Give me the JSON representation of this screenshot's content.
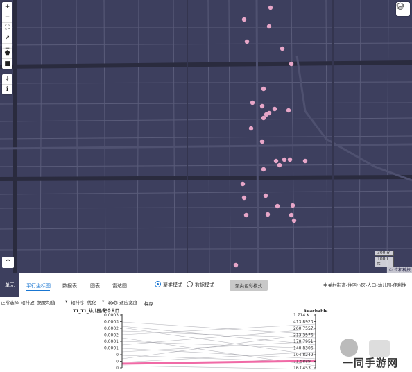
{
  "map": {
    "toolbar_top": [
      {
        "name": "plus-icon",
        "glyph": "+"
      },
      {
        "name": "minus-icon",
        "glyph": "−"
      },
      {
        "name": "fullscreen-icon",
        "glyph": "⛶"
      },
      {
        "name": "expand-icon",
        "glyph": "↗"
      },
      {
        "name": "minus-icon",
        "glyph": "−"
      }
    ],
    "toolbar_mid": [
      {
        "name": "polygon-icon",
        "glyph": "⬟"
      },
      {
        "name": "square-icon",
        "glyph": "■"
      }
    ],
    "toolbar_bot": [
      {
        "name": "download-icon",
        "glyph": "⤓"
      },
      {
        "name": "info-icon",
        "glyph": "ℹ"
      }
    ],
    "up_glyph": "^",
    "scale_m": "300 m",
    "scale_ft": "1000 ft",
    "attribution": "© 位和科技",
    "point_color": "#e7a6c8"
  },
  "panel": {
    "tab_first": "单元",
    "tabs": [
      "平行坐标图",
      "数据表",
      "图表",
      "雷达图"
    ],
    "radio1": "聚类模式",
    "radio2": "数据模式",
    "cluster_button": "聚类色彩模式",
    "breadcrumb": "中关村街道-住宅小区-人口-幼儿园-便利性",
    "toolbar": {
      "t1": "正常选择",
      "t2": "轴排放: 据要均值",
      "t3": "轴排序: 优化",
      "t4": "滚动: 适应宽度",
      "t5": "保存"
    }
  },
  "chart_data": {
    "type": "parallel-coordinates",
    "axes": [
      {
        "name": "T1_T1_幼儿园/配合人口",
        "ticks": [
          "0.0003",
          "0.0003",
          "0.0002",
          "0.0002",
          "0.0001",
          "0.0001",
          "0",
          "0",
          "0"
        ]
      },
      {
        "name": "Reachable",
        "ticks": [
          "1.714 K",
          "413.8923",
          "260.7557",
          "213.3576",
          "170.7951",
          "140.8306",
          "104.8249",
          "71.5889",
          "16.0453"
        ]
      }
    ],
    "highlight_color": "#f06aa6",
    "line_color": "#9a9aa3"
  },
  "watermark": "一同手游网"
}
